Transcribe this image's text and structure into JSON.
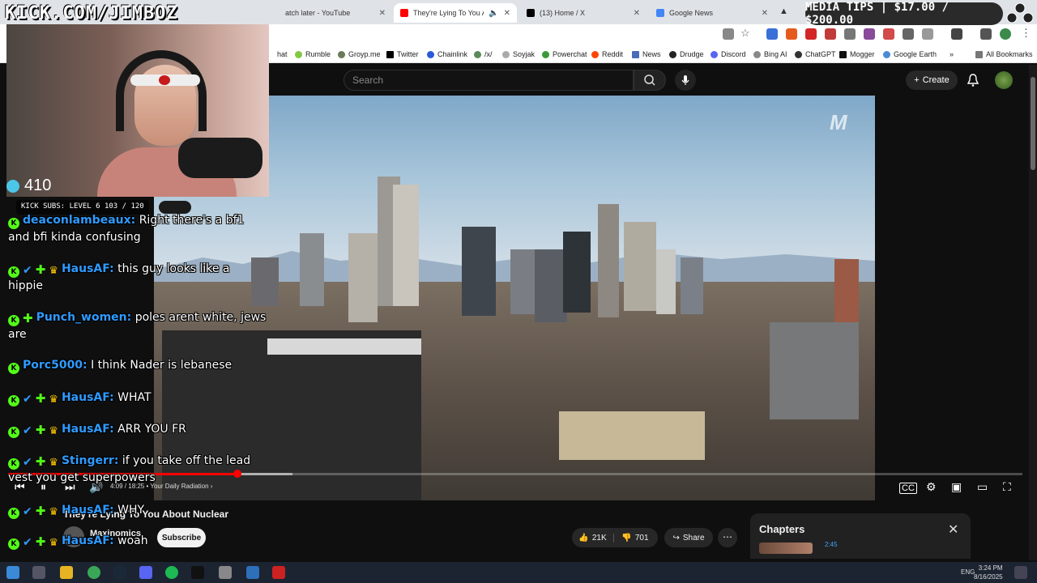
{
  "stream_overlay": {
    "handle": "KICK.COM/JIMBOZ",
    "viewer_count": "410",
    "kick_subs": "KICK SUBS: LEVEL 6 103 / 120",
    "media_tips": "MEDIA TIPS | $17.00 / $200.00"
  },
  "browser": {
    "tabs": [
      {
        "title": "atch later - YouTube",
        "active": false
      },
      {
        "title": "They're Lying To You About",
        "active": true
      },
      {
        "title": "(13) Home / X",
        "active": false
      },
      {
        "title": "Google News",
        "active": false
      }
    ],
    "bookmarks": [
      "hat",
      "Rumble",
      "Groyp.me",
      "Twitter",
      "Chainlink",
      "/x/",
      "Soyjak",
      "Powerchat",
      "Reddit",
      "News",
      "Drudge",
      "Discord",
      "Bing AI",
      "ChatGPT",
      "Mogger",
      "Google Earth"
    ],
    "all_bookmarks": "All Bookmarks"
  },
  "youtube": {
    "search_placeholder": "Search",
    "create_label": "Create",
    "video_title": "They're Lying To You About Nuclear",
    "channel_name": "Maxinomics",
    "subscribe_label": "Subscribe",
    "likes": "21K",
    "dislikes": "701",
    "share_label": "Share",
    "chapters_title": "Chapters",
    "chapter_time": "2:45",
    "timecode": "4:09 / 18:25",
    "chapter_name": "Your Daily Radiation",
    "progress_fraction": 0.226,
    "buffered_fraction": 0.28
  },
  "chat": [
    {
      "user": "deaconlambeaux",
      "msg": "Right there's a bf1 and bfi kinda confusing",
      "badges": [
        "kick"
      ]
    },
    {
      "user": "HausAF",
      "msg": "this guy looks like a hippie",
      "badges": [
        "kick",
        "sword",
        "diamond",
        "crown"
      ]
    },
    {
      "user": "Punch_women",
      "msg": "poles arent white, jews are",
      "badges": [
        "kick",
        "diamond"
      ]
    },
    {
      "user": "Porc5000",
      "msg": "I think Nader is lebanese",
      "badges": [
        "kick"
      ]
    },
    {
      "user": "HausAF",
      "msg": "WHAT",
      "badges": [
        "kick",
        "sword",
        "diamond",
        "crown"
      ]
    },
    {
      "user": "HausAF",
      "msg": "ARR YOU FR",
      "badges": [
        "kick",
        "sword",
        "diamond",
        "crown"
      ]
    },
    {
      "user": "Stingerr",
      "msg": "if you take off the lead vest you get superpowers",
      "badges": [
        "kick",
        "sword",
        "diamond",
        "crown"
      ]
    },
    {
      "user": "HausAF",
      "msg": "WHY",
      "badges": [
        "kick",
        "sword",
        "diamond",
        "crown"
      ]
    },
    {
      "user": "HausAF",
      "msg": "woah",
      "badges": [
        "kick",
        "sword",
        "diamond",
        "crown"
      ]
    }
  ],
  "taskbar": {
    "lang": "ENG",
    "time": "3:24 PM",
    "date": "8/16/2025"
  },
  "colors": {
    "kick_green": "#53fc18",
    "yt_red": "#ff0000",
    "yt_bg": "#0f0f0f"
  }
}
